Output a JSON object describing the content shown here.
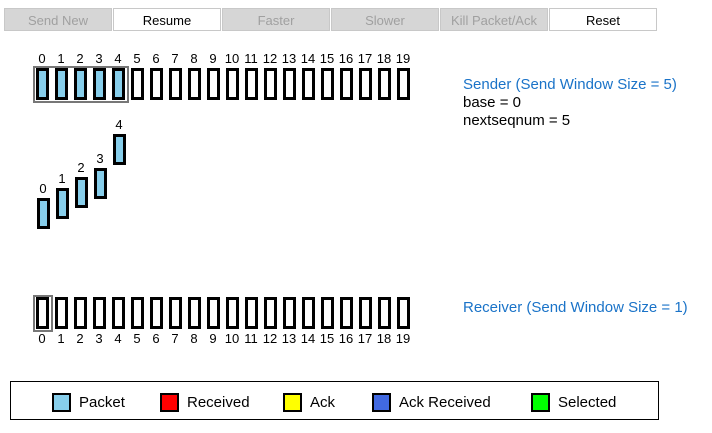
{
  "toolbar": {
    "buttons": [
      {
        "label": "Send New",
        "enabled": false
      },
      {
        "label": "Resume",
        "enabled": true
      },
      {
        "label": "Faster",
        "enabled": false
      },
      {
        "label": "Slower",
        "enabled": false
      },
      {
        "label": "Kill Packet/Ack",
        "enabled": false
      },
      {
        "label": "Reset",
        "enabled": true
      }
    ]
  },
  "sender": {
    "title": "Sender (Send Window Size = 5)",
    "base": "base = 0",
    "nextseqnum": "nextseqnum = 5",
    "sent": [
      0,
      1,
      2,
      3,
      4
    ],
    "window_start": 0,
    "window_size": 5
  },
  "receiver": {
    "title": "Receiver (Send Window Size = 1)",
    "window_start": 0,
    "window_size": 1
  },
  "seq_count": 20,
  "in_flight": [
    {
      "seq": "0"
    },
    {
      "seq": "1"
    },
    {
      "seq": "2"
    },
    {
      "seq": "3"
    },
    {
      "seq": "4"
    }
  ],
  "legend": [
    {
      "label": "Packet",
      "color": "#87ceeb"
    },
    {
      "label": "Received",
      "color": "#ff0000"
    },
    {
      "label": "Ack",
      "color": "#ffff00"
    },
    {
      "label": "Ack Received",
      "color": "#4169e1"
    },
    {
      "label": "Selected",
      "color": "#00ff00"
    }
  ]
}
